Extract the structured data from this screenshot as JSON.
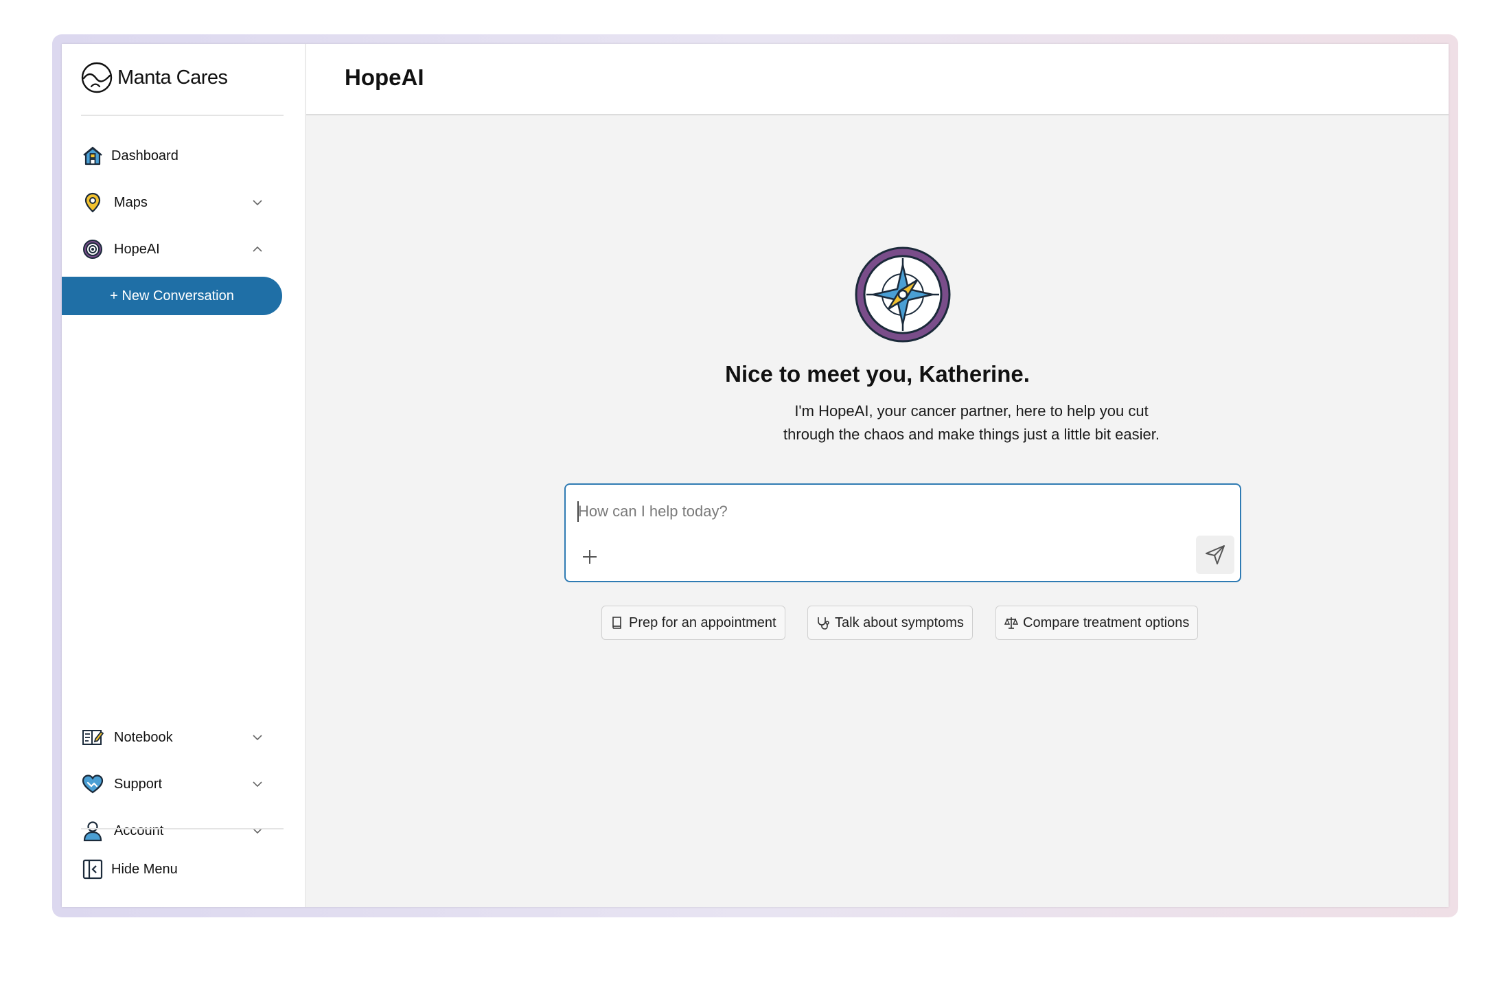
{
  "brand": {
    "name": "Manta Cares"
  },
  "header": {
    "title": "HopeAI"
  },
  "sidebar": {
    "items": [
      {
        "label": "Dashboard",
        "icon": "house-icon"
      },
      {
        "label": "Maps",
        "icon": "map-pin-icon",
        "expandable": true
      },
      {
        "label": "HopeAI",
        "icon": "target-icon",
        "expandable": true,
        "expanded": true
      },
      {
        "label": "Notebook",
        "icon": "notebook-icon",
        "expandable": true
      },
      {
        "label": "Support",
        "icon": "heart-handshake-icon",
        "expandable": true
      },
      {
        "label": "Account",
        "icon": "user-icon",
        "expandable": true
      }
    ],
    "new_conversation": "+ New Conversation",
    "hide_menu": "Hide Menu"
  },
  "main": {
    "greeting": "Nice to meet you, Katherine.",
    "intro_line1": "I'm HopeAI, your cancer partner, here to help you cut",
    "intro_line2": "through the chaos and make things just a little bit easier.",
    "chat": {
      "placeholder": "How can I help today?",
      "value": ""
    },
    "suggestions": [
      {
        "label": "Prep for an appointment",
        "icon": "book-icon"
      },
      {
        "label": "Talk about symptoms",
        "icon": "stethoscope-icon"
      },
      {
        "label": "Compare treatment options",
        "icon": "scale-icon"
      }
    ]
  },
  "colors": {
    "primary": "#1f6fa6",
    "focus_border": "#2f7bb3",
    "compass_ring": "#7a4d8a",
    "accent_yellow": "#f2c230",
    "accent_blue": "#4a9fd4"
  }
}
